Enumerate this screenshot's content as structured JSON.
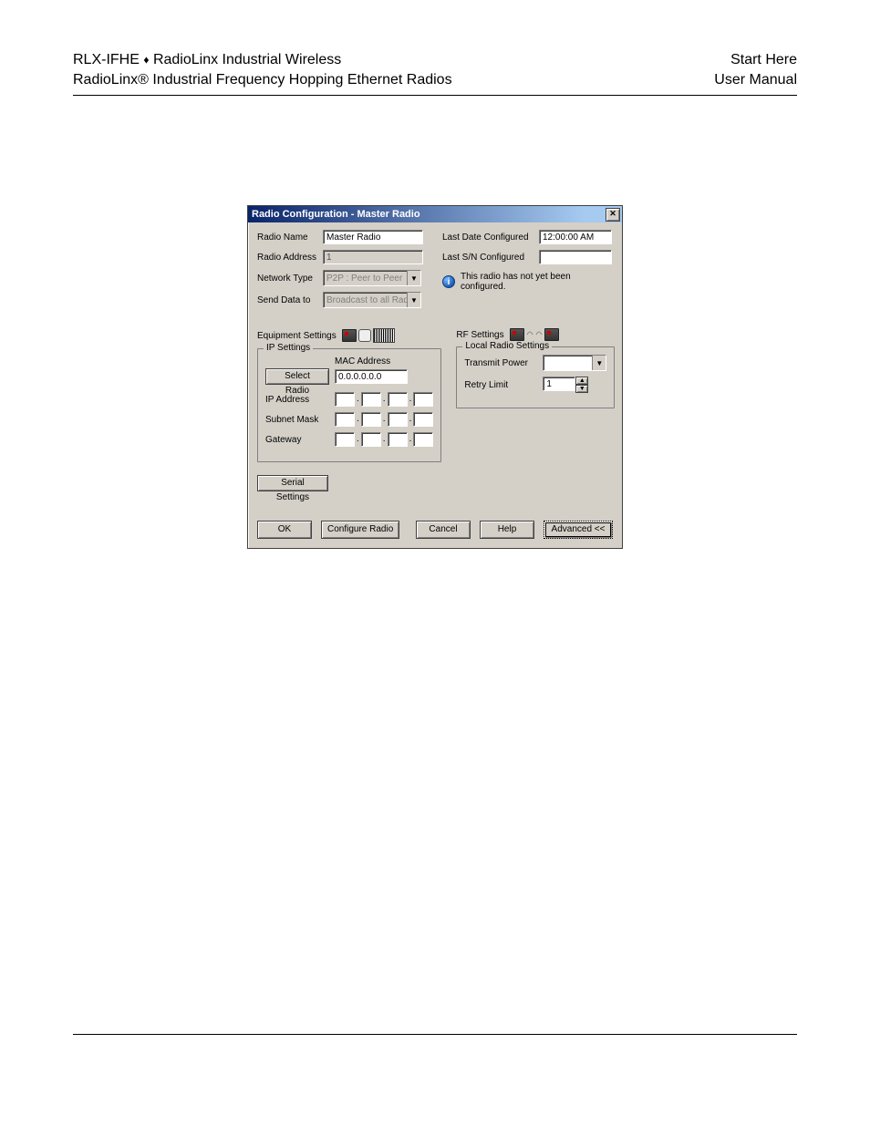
{
  "header": {
    "left_line1_a": "RLX-IFHE",
    "left_line1_sep": "♦",
    "left_line1_b": "RadioLinx Industrial Wireless",
    "left_line2": "RadioLinx® Industrial Frequency Hopping Ethernet Radios",
    "right_line1": "Start Here",
    "right_line2": "User Manual"
  },
  "dialog": {
    "title": "Radio Configuration - Master Radio",
    "radio_name_label": "Radio Name",
    "radio_name_value": "Master Radio",
    "radio_address_label": "Radio Address",
    "radio_address_value": "1",
    "network_type_label": "Network Type",
    "network_type_value": "P2P : Peer to Peer",
    "send_data_label": "Send Data to",
    "send_data_value": "Broadcast to all Radios",
    "last_date_label": "Last Date Configured",
    "last_date_value": "12:00:00 AM",
    "last_sn_label": "Last S/N Configured",
    "last_sn_value": "",
    "status_message": "This radio has not yet been configured.",
    "equipment_settings_label": "Equipment Settings",
    "rf_settings_label": "RF Settings",
    "ip_group_label": "IP Settings",
    "mac_address_label": "MAC Address",
    "select_radio_button": "Select Radio",
    "mac_value": "0.0.0.0.0.0",
    "ip_address_label": "IP Address",
    "subnet_mask_label": "Subnet Mask",
    "gateway_label": "Gateway",
    "serial_settings_button": "Serial Settings",
    "local_radio_group_label": "Local Radio Settings",
    "transmit_power_label": "Transmit Power",
    "retry_limit_label": "Retry Limit",
    "retry_limit_value": "1",
    "ok_button": "OK",
    "configure_radio_button": "Configure Radio",
    "cancel_button": "Cancel",
    "help_button": "Help",
    "advanced_button": "Advanced <<"
  }
}
